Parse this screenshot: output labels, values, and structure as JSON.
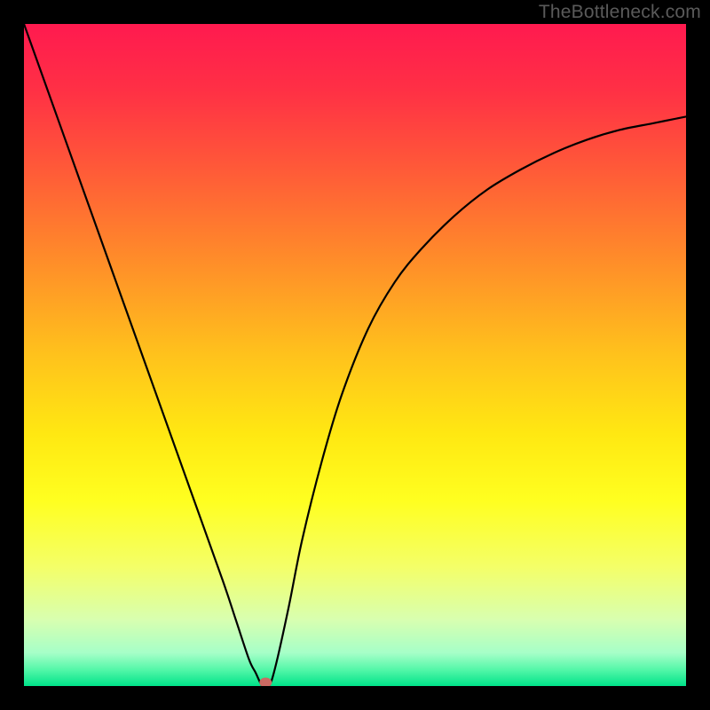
{
  "watermark": "TheBottleneck.com",
  "chart_data": {
    "type": "line",
    "title": "",
    "xlabel": "",
    "ylabel": "",
    "xlim": [
      0,
      100
    ],
    "ylim": [
      0,
      100
    ],
    "grid": false,
    "legend": false,
    "series": [
      {
        "name": "curve",
        "x": [
          0,
          5,
          10,
          15,
          20,
          25,
          30,
          32,
          34,
          35,
          36,
          37,
          38,
          40,
          42,
          45,
          48,
          52,
          56,
          60,
          65,
          70,
          75,
          80,
          85,
          90,
          95,
          100
        ],
        "y": [
          100,
          86,
          72,
          58,
          44,
          30,
          16,
          10,
          4,
          2,
          0,
          0,
          3,
          12,
          22,
          34,
          44,
          54,
          61,
          66,
          71,
          75,
          78,
          80.5,
          82.5,
          84,
          85,
          86
        ]
      }
    ],
    "marker": {
      "x": 36.5,
      "y": 0,
      "color": "#cc6a63"
    },
    "background_gradient_stops": [
      {
        "offset": 0.0,
        "color": "#ff1a4f"
      },
      {
        "offset": 0.1,
        "color": "#ff3045"
      },
      {
        "offset": 0.22,
        "color": "#ff5a38"
      },
      {
        "offset": 0.35,
        "color": "#ff8a2a"
      },
      {
        "offset": 0.5,
        "color": "#ffc21c"
      },
      {
        "offset": 0.62,
        "color": "#ffe812"
      },
      {
        "offset": 0.72,
        "color": "#ffff20"
      },
      {
        "offset": 0.82,
        "color": "#f4ff68"
      },
      {
        "offset": 0.9,
        "color": "#d8ffb0"
      },
      {
        "offset": 0.95,
        "color": "#a6ffc8"
      },
      {
        "offset": 0.975,
        "color": "#55f7a9"
      },
      {
        "offset": 1.0,
        "color": "#00e389"
      }
    ]
  }
}
